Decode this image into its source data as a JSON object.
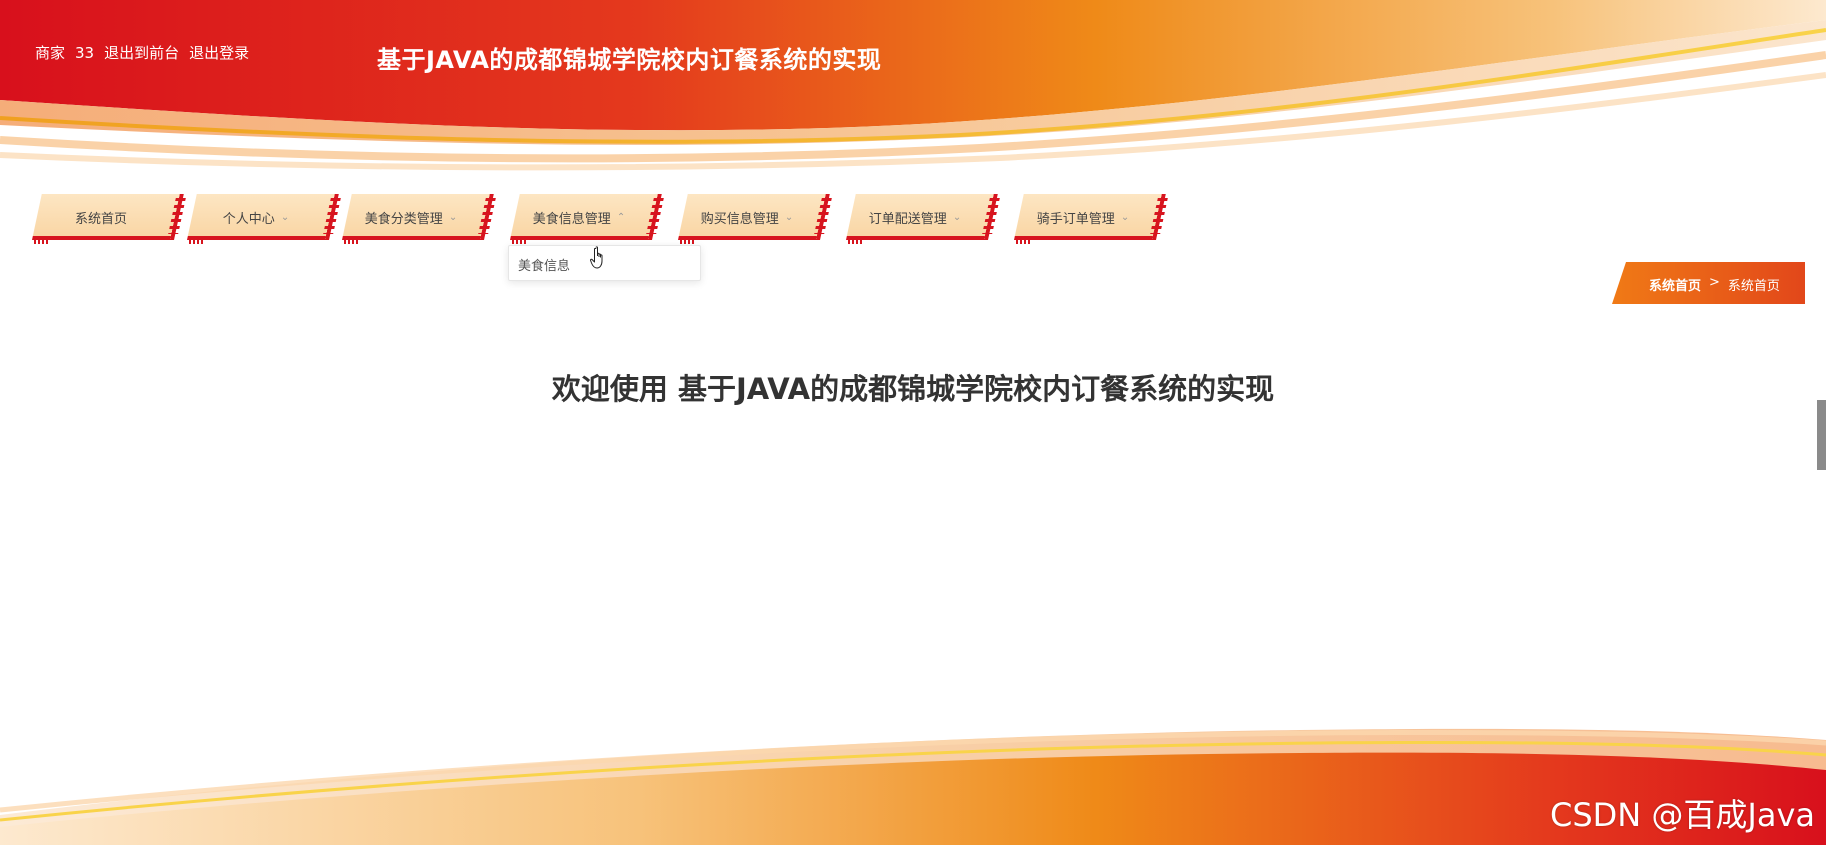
{
  "header": {
    "user_role": "商家",
    "user_name": "33",
    "back_to_front_label": "退出到前台",
    "logout_label": "退出登录",
    "site_title": "基于JAVA的成都锦城学院校内订餐系统的实现"
  },
  "nav": {
    "items": [
      {
        "label": "系统首页",
        "has_dropdown": false
      },
      {
        "label": "个人中心",
        "has_dropdown": true
      },
      {
        "label": "美食分类管理",
        "has_dropdown": true
      },
      {
        "label": "美食信息管理",
        "has_dropdown": true,
        "expanded": true
      },
      {
        "label": "购买信息管理",
        "has_dropdown": true
      },
      {
        "label": "订单配送管理",
        "has_dropdown": true
      },
      {
        "label": "骑手订单管理",
        "has_dropdown": true
      }
    ],
    "dropdown_items": [
      "美食信息"
    ]
  },
  "breadcrumb": {
    "first": "系统首页",
    "separator": ">",
    "current": "系统首页"
  },
  "main": {
    "welcome_text": "欢迎使用 基于JAVA的成都锦城学院校内订餐系统的实现"
  },
  "watermark": "CSDN @百成Java",
  "colors": {
    "brand_red": "#d7141e",
    "brand_orange": "#f07a16",
    "nav_tile": "#fde6c3"
  },
  "icons": {
    "chevron_down": "chevron-down-icon",
    "chevron_up": "chevron-up-icon",
    "cursor": "hand-pointer-icon"
  }
}
